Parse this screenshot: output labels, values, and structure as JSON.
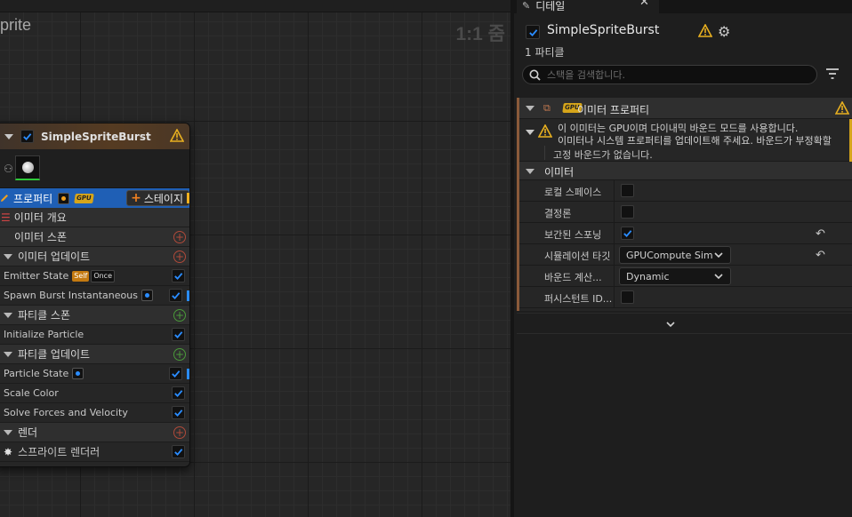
{
  "graph": {
    "title": "prite",
    "zoom_label": "1:1 줌"
  },
  "node": {
    "name": "SimpleSpriteBurst",
    "properties_label": "프로퍼티",
    "gpu_badge": "GPU",
    "add_stage_label": "스테이지",
    "rows": [
      {
        "kind": "item",
        "label": "이미터 개요"
      },
      {
        "kind": "item",
        "label": "이미터 스폰"
      },
      {
        "kind": "section",
        "label": "이미터 업데이트"
      },
      {
        "kind": "module",
        "label": "Emitter State"
      },
      {
        "kind": "module",
        "label": "Spawn Burst Instantaneous"
      },
      {
        "kind": "section",
        "label": "파티클 스폰"
      },
      {
        "kind": "module",
        "label": "Initialize Particle"
      },
      {
        "kind": "section",
        "label": "파티클 업데이트"
      },
      {
        "kind": "module",
        "label": "Particle State"
      },
      {
        "kind": "module",
        "label": "Scale Color"
      },
      {
        "kind": "module",
        "label": "Solve Forces and Velocity"
      },
      {
        "kind": "section",
        "label": "렌더"
      },
      {
        "kind": "module",
        "label": "스프라이트 렌더러"
      }
    ],
    "tag_self": "Self",
    "tag_once": "Once"
  },
  "details": {
    "tab_label": "디테일",
    "emitter_name": "SimpleSpriteBurst",
    "particle_count": "1 파티클",
    "search": {
      "placeholder": "스택을 검색합니다."
    },
    "emitter_properties_label": "이미터 프로퍼티",
    "gpu_badge": "GPU",
    "warning_line1": "이 이미터는 GPU이며 다이내믹 바운드 모드를 사용합니다.",
    "warning_line2": "이미터나 시스템 프로퍼티를 업데이트해 주세요. 바운드가 부정확할 수",
    "warning_sub": "고정 바운드가 없습니다.",
    "emitter_section_label": "이미터",
    "props": {
      "local_space": "로컬 스페이스",
      "determinism": "결정론",
      "interpolated_spawning": "보간된 스포닝",
      "sim_target": "시뮬레이션 타깃",
      "sim_target_value": "GPUCompute Sim",
      "calc_bounds": "바운드 계산...",
      "calc_bounds_value": "Dynamic",
      "persistent_id": "퍼시스턴트 ID..."
    }
  },
  "colors": {
    "accent_blue": "#1f5fb5",
    "warning_yellow": "#d6a51a",
    "check_blue": "#2a8cff"
  }
}
